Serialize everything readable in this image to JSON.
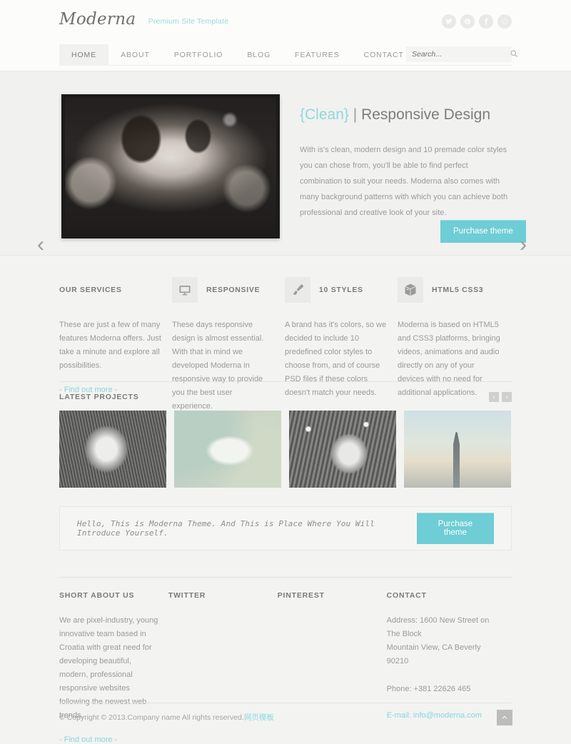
{
  "side_tab": {
    "label": "Moderna"
  },
  "header": {
    "logo": "Moderna",
    "tagline": "Premium Site Template",
    "social": [
      {
        "name": "twitter-icon",
        "glyph": "t"
      },
      {
        "name": "pinterest-icon",
        "glyph": "p"
      },
      {
        "name": "facebook-icon",
        "glyph": "f"
      },
      {
        "name": "dribbble-icon",
        "glyph": "d"
      }
    ]
  },
  "nav": {
    "items": [
      {
        "label": "HOME",
        "active": true
      },
      {
        "label": "ABOUT",
        "active": false
      },
      {
        "label": "PORTFOLIO",
        "active": false
      },
      {
        "label": "BLOG",
        "active": false
      },
      {
        "label": "FEATURES",
        "active": false
      },
      {
        "label": "CONTACT",
        "active": false
      }
    ],
    "search": {
      "placeholder": "Search...",
      "value": "",
      "icon": "search-icon"
    }
  },
  "hero": {
    "title_highlight": "{Clean}",
    "title_separator": "|",
    "title_rest": "Responsive Design",
    "body": "With is's clean, modern design and 10 premade color styles you can chose from, you'll be able to find perfect combination to suit your needs. Moderna also comes with many background patterns with which you can achieve both professional and creative look of your site.",
    "cta": "Purchase theme",
    "prev_arrow": "‹",
    "next_arrow": "›",
    "accent": "#8ed8dd"
  },
  "services": [
    {
      "title": "OUR SERVICES",
      "icon": "",
      "body": "These are just a few of many features Moderna offers. Just take a minute and explore all possibilities.",
      "link": "- Find out more -"
    },
    {
      "title": "RESPONSIVE",
      "icon": "monitor-icon",
      "body": "These days responsive design is almost essential. With that in mind we developed Moderna in responsive way to provide you the best user experience.",
      "link": ""
    },
    {
      "title": "10 STYLES",
      "icon": "paintbrush-icon",
      "body": "A brand has it's colors, so we decided to include 10 predefined color styles to choose from, and of course PSD files if these colors doesn't match your needs.",
      "link": ""
    },
    {
      "title": "HTML5 CSS3",
      "icon": "box-icon",
      "body": "Moderna is based on HTML5 and CSS3 platforms, bringing videos, animations and audio directly on any of your devices with no need for additional applications.",
      "link": ""
    }
  ],
  "projects": {
    "title": "LATEST PROJECTS",
    "prev": "‹",
    "next": "›",
    "items": [
      {
        "name": "project-thumb-girl-in-grass"
      },
      {
        "name": "project-thumb-trust-hand"
      },
      {
        "name": "project-thumb-headdress"
      },
      {
        "name": "project-thumb-city-skyline"
      }
    ]
  },
  "callout": {
    "text": "Hello, This is Moderna Theme. And This is Place Where You Will Introduce Yourself.",
    "cta": "Purchase theme"
  },
  "footer": {
    "columns": [
      {
        "heading": "SHORT ABOUT US",
        "body": "We are pixel-industry, young innovative team based in Croatia with great need for developing beautiful, modern, professional responsive websites following the newest web trends.",
        "link": "- Find out more -"
      },
      {
        "heading": "TWITTER",
        "body": "",
        "link": ""
      },
      {
        "heading": "PINTEREST",
        "body": "",
        "link": ""
      }
    ],
    "contact": {
      "heading": "CONTACT",
      "address": "Address: 1600 New Street on The Block\nMountain View, CA Beverly 90210",
      "phone": "Phone: +381 22626 465",
      "email_label": "E-mail: info@moderna.com"
    }
  },
  "copyright": {
    "text": "© Copyright © 2013.Company name All rights reserved.",
    "cn_link": "网页模板",
    "to_top": "▲"
  }
}
